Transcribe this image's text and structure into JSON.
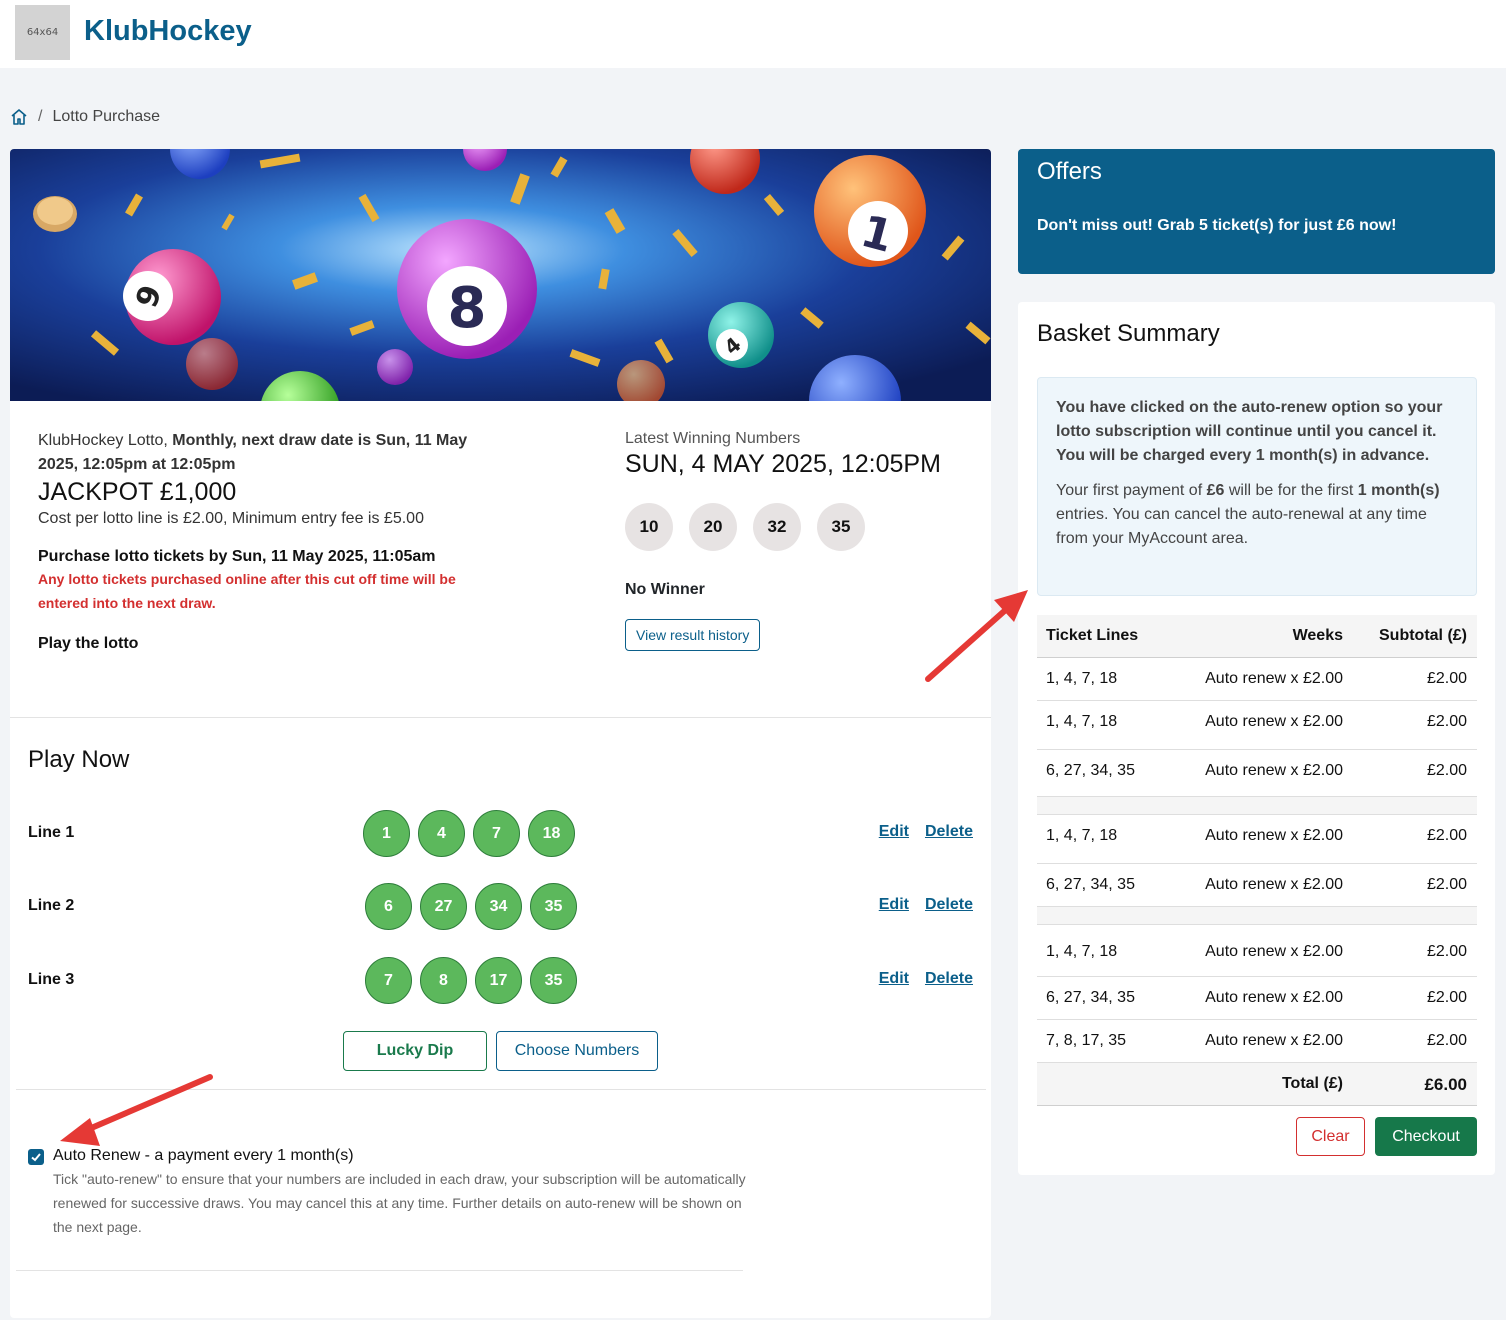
{
  "header": {
    "logo_placeholder": "64x64",
    "brand": "KlubHockey"
  },
  "breadcrumb": {
    "home_icon": "home-icon",
    "current": "Lotto Purchase"
  },
  "lotto": {
    "lead_plain": "KlubHockey Lotto, ",
    "lead_bold": "Monthly, next draw date is Sun, 11 May 2025, 12:05pm at 12:05pm",
    "jackpot": "JACKPOT £1,000",
    "cost": "Cost per lotto line is £2.00, Minimum entry fee is £5.00",
    "cutoff": "Purchase lotto tickets by Sun, 11 May 2025, 11:05am",
    "warning": "Any lotto tickets purchased online after this cut off time will be entered into the next draw.",
    "play_label": "Play the lotto"
  },
  "latest": {
    "label": "Latest Winning Numbers",
    "date": "SUN, 4 MAY 2025, 12:05PM",
    "numbers": [
      "10",
      "20",
      "32",
      "35"
    ],
    "result": "No Winner",
    "history_button": "View result history"
  },
  "play_now": {
    "title": "Play Now",
    "edit_label": "Edit",
    "delete_label": "Delete",
    "lines": [
      {
        "label": "Line 1",
        "numbers": [
          "1",
          "4",
          "7",
          "18"
        ]
      },
      {
        "label": "Line 2",
        "numbers": [
          "6",
          "27",
          "34",
          "35"
        ]
      },
      {
        "label": "Line 3",
        "numbers": [
          "7",
          "8",
          "17",
          "35"
        ]
      }
    ],
    "lucky_dip": "Lucky Dip",
    "choose_numbers": "Choose Numbers"
  },
  "auto_renew": {
    "checked": true,
    "label": "Auto Renew - a payment every 1 month(s)",
    "description": "Tick \"auto-renew\" to ensure that your numbers are included in each draw, your subscription will be automatically renewed for successive draws. You may cancel this at any time. Further details on auto-renew will be shown on the next page."
  },
  "offers": {
    "title": "Offers",
    "text": "Don't miss out! Grab 5 ticket(s) for just £6 now!"
  },
  "basket": {
    "title": "Basket Summary",
    "notice_bold": "You have clicked on the auto-renew option so your lotto subscription will continue until you cancel it. You will be charged every 1 month(s) in advance.",
    "notice_p1": "Your first payment of ",
    "notice_amount": "£6",
    "notice_p2": " will be for the first ",
    "notice_period": "1 month(s)",
    "notice_p3": " entries. You can cancel the auto-renewal at any time from your MyAccount area.",
    "headers": [
      "Ticket Lines",
      "Weeks",
      "Subtotal (£)"
    ],
    "groups": [
      [
        {
          "lines": "1, 4, 7, 18",
          "weeks": "Auto renew x £2.00",
          "subtotal": "£2.00"
        },
        {
          "lines": "1, 4, 7, 18",
          "weeks": "Auto renew x £2.00",
          "subtotal": "£2.00"
        },
        {
          "lines": "6, 27, 34, 35",
          "weeks": "Auto renew x £2.00",
          "subtotal": "£2.00"
        }
      ],
      [
        {
          "lines": "1, 4, 7, 18",
          "weeks": "Auto renew x £2.00",
          "subtotal": "£2.00"
        },
        {
          "lines": "6, 27, 34, 35",
          "weeks": "Auto renew x £2.00",
          "subtotal": "£2.00"
        }
      ],
      [
        {
          "lines": "1, 4, 7, 18",
          "weeks": "Auto renew x £2.00",
          "subtotal": "£2.00"
        },
        {
          "lines": "6, 27, 34, 35",
          "weeks": "Auto renew x £2.00",
          "subtotal": "£2.00"
        },
        {
          "lines": "7, 8, 17, 35",
          "weeks": "Auto renew x £2.00",
          "subtotal": "£2.00"
        }
      ]
    ],
    "total_label": "Total (£)",
    "total_value": "£6.00",
    "clear_button": "Clear",
    "checkout_button": "Checkout"
  },
  "colors": {
    "brand": "#0b5f8a",
    "ball_green": "#5cb85c",
    "checkout": "#16784a",
    "warning": "#d32f2f",
    "annotation_arrow": "#e53935"
  }
}
